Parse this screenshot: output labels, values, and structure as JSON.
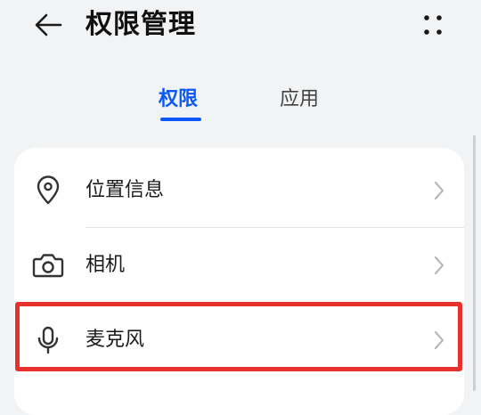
{
  "header": {
    "title": "权限管理",
    "back_icon": "back-arrow-icon",
    "more_icon": "more-dots-icon"
  },
  "tabs": [
    {
      "label": "权限",
      "active": true
    },
    {
      "label": "应用",
      "active": false
    }
  ],
  "permissions": [
    {
      "label": "位置信息",
      "icon": "location-pin-icon"
    },
    {
      "label": "相机",
      "icon": "camera-icon"
    },
    {
      "label": "麦克风",
      "icon": "microphone-icon",
      "highlighted": true
    }
  ],
  "colors": {
    "accent": "#0a59f7",
    "highlight": "#e8302c",
    "background": "#f1f3f5",
    "card": "#ffffff"
  }
}
